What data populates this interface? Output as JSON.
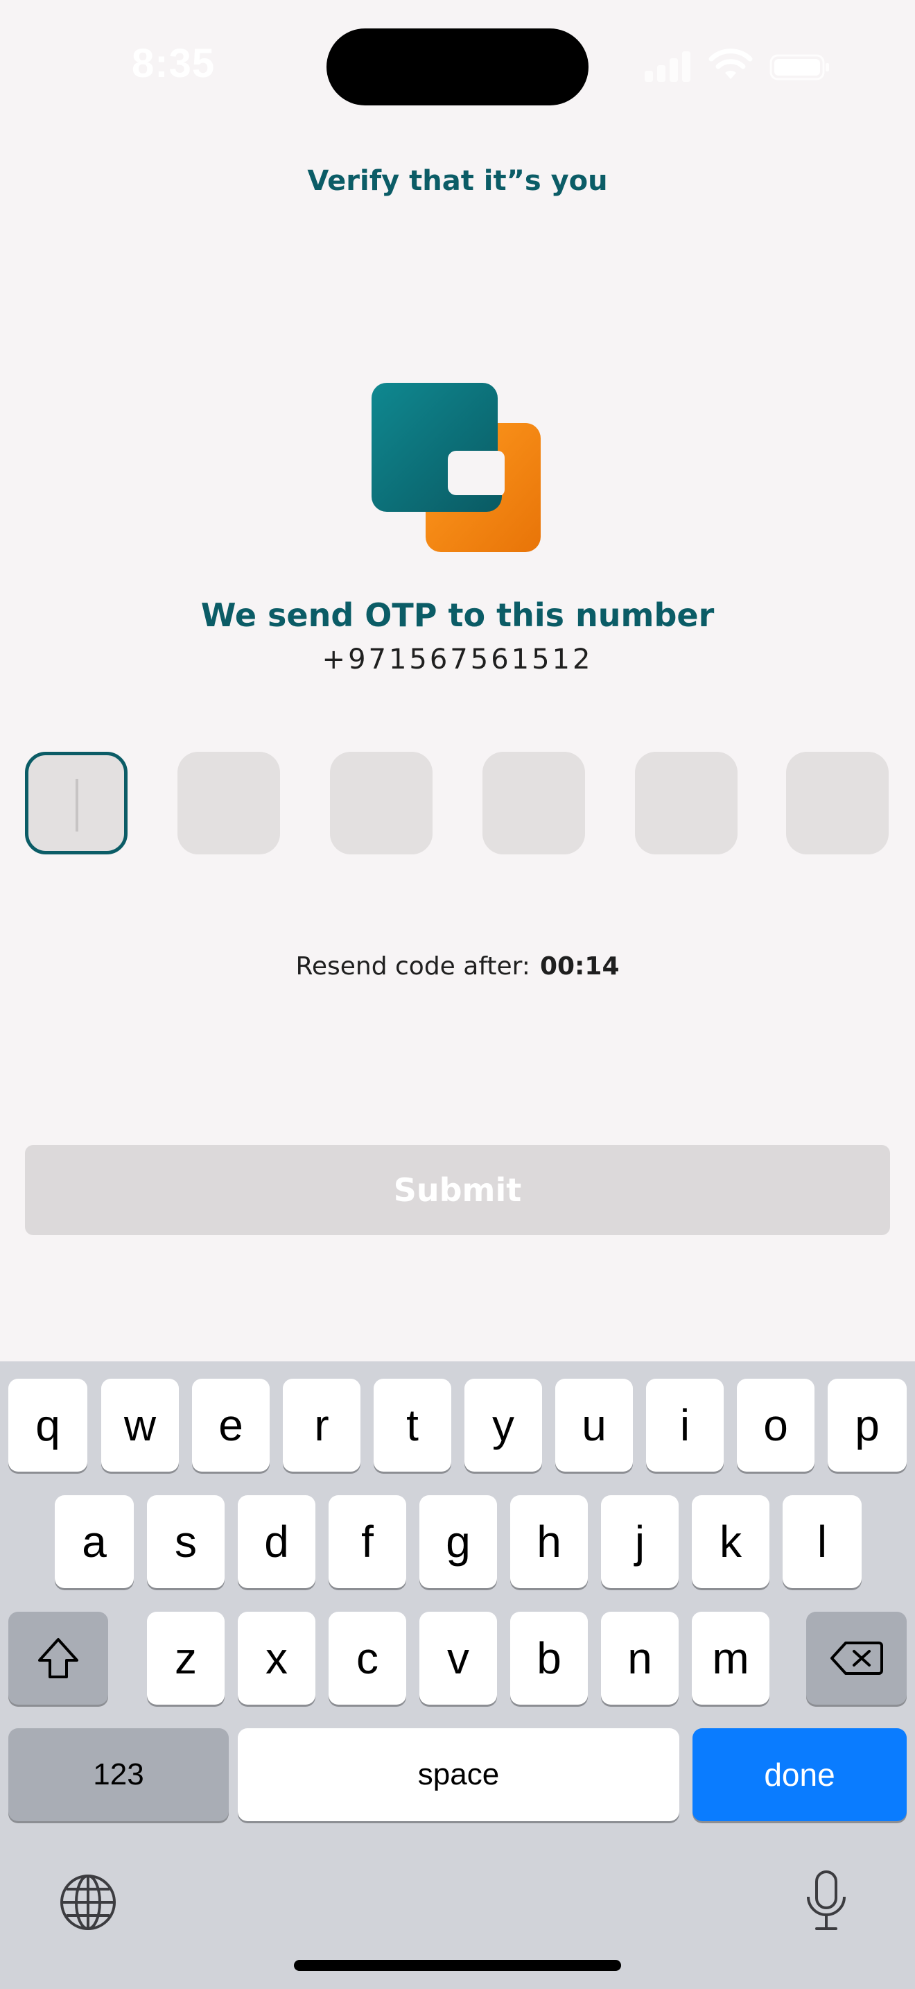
{
  "status_bar": {
    "time": "8:35",
    "icons": [
      "signal-icon",
      "wifi-icon",
      "battery-icon"
    ]
  },
  "page": {
    "title": "Verify that it”s you",
    "heading": "We send OTP to this number",
    "phone": "+971567561512"
  },
  "otp": {
    "length": 6,
    "values": [
      "",
      "",
      "",
      "",
      "",
      ""
    ],
    "active_index": 0
  },
  "resend": {
    "label": "Resend code after:",
    "timer": "00:14"
  },
  "submit": {
    "label": "Submit",
    "enabled": false
  },
  "keyboard": {
    "row1": [
      "q",
      "w",
      "e",
      "r",
      "t",
      "y",
      "u",
      "i",
      "o",
      "p"
    ],
    "row2": [
      "a",
      "s",
      "d",
      "f",
      "g",
      "h",
      "j",
      "k",
      "l"
    ],
    "row3": [
      "z",
      "x",
      "c",
      "v",
      "b",
      "n",
      "m"
    ],
    "numbers_label": "123",
    "space_label": "space",
    "done_label": "done",
    "icons": [
      "shift-icon",
      "backspace-icon",
      "globe-icon",
      "mic-icon"
    ]
  },
  "colors": {
    "brand_teal": "#0b5c66",
    "brand_orange": "#f5860f",
    "background": "#f7f4f5",
    "key_blue": "#0a7cff"
  }
}
